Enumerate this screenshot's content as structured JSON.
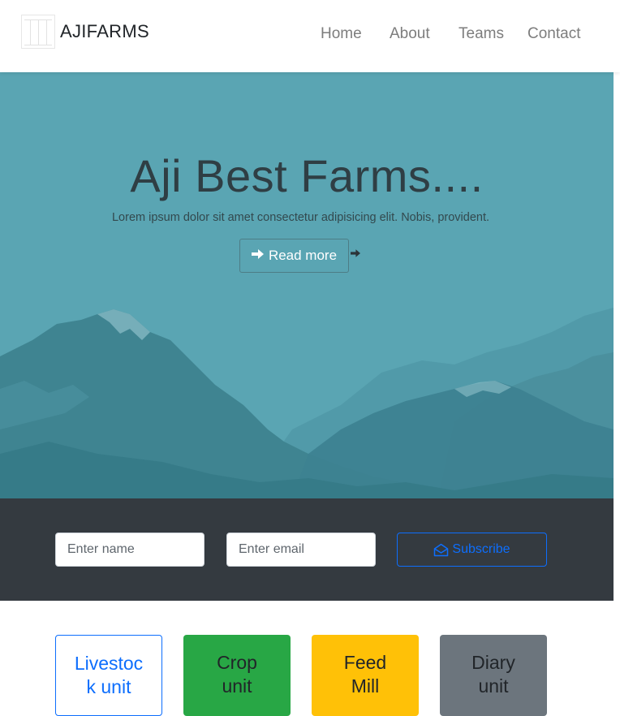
{
  "navbar": {
    "brand_name": "AJIFARMS",
    "links": [
      "Home",
      "About",
      "Teams",
      "Contact"
    ]
  },
  "hero": {
    "title": "Aji Best Farms....",
    "subtitle": "Lorem ipsum dolor sit amet consectetur adipisicing elit. Nobis, provident.",
    "button_label": "Read more",
    "button_icon": "arrow-right-icon"
  },
  "subscribe": {
    "name_placeholder": "Enter name",
    "email_placeholder": "Enter email",
    "button_label": "Subscribe",
    "button_icon": "envelope-open-icon"
  },
  "units": [
    {
      "line1": "Livestoc",
      "line2": "k unit",
      "style": "outline-primary"
    },
    {
      "line1": "Crop",
      "line2": "unit",
      "style": "success"
    },
    {
      "line1": "Feed",
      "line2": "Mill",
      "style": "warning"
    },
    {
      "line1": "Diary",
      "line2": "unit",
      "style": "secondary"
    }
  ],
  "colors": {
    "hero_bg": "#5aa5b3",
    "dark_band": "#343a40",
    "primary": "#0d6efd",
    "success": "#28a745",
    "warning": "#ffc107",
    "secondary": "#6c757d"
  }
}
